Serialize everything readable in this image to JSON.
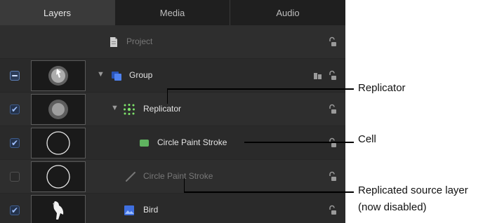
{
  "tabs": [
    {
      "label": "Layers",
      "active": true
    },
    {
      "label": "Media",
      "active": false
    },
    {
      "label": "Audio",
      "active": false
    }
  ],
  "rows": {
    "project": {
      "label": "Project"
    },
    "group": {
      "label": "Group"
    },
    "replicator": {
      "label": "Replicator"
    },
    "cell": {
      "label": "Circle Paint Stroke"
    },
    "source": {
      "label": "Circle Paint Stroke"
    },
    "bird": {
      "label": "Bird"
    }
  },
  "callouts": {
    "replicator": "Replicator",
    "cell": "Cell",
    "source_line1": "Replicated source layer",
    "source_line2": "(now disabled)"
  },
  "colors": {
    "panel_bg": "#2b2b2b",
    "checkbox_accent": "#9fc0ff",
    "replicator_icon": "#7ee36a",
    "cell_icon": "#5fb35f",
    "group_icon": "#3f6fe0",
    "callout_line": "#000000"
  }
}
